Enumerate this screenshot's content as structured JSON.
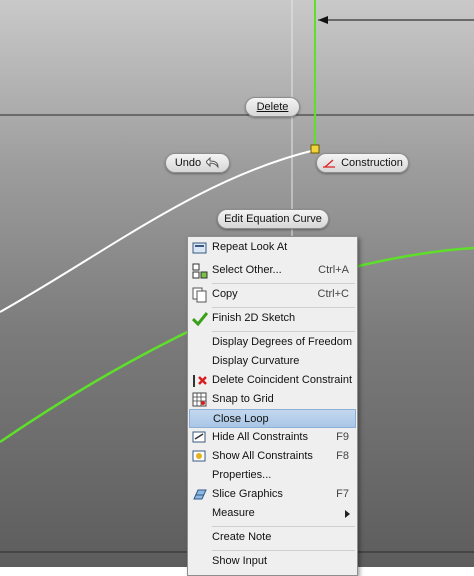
{
  "canvas": {
    "background_top": "#c9c9c9",
    "background_bottom": "#5d5d5d",
    "curve_white": "#ffffff",
    "curve_green": "#5ee02a",
    "axis_line": "#2b2b2b"
  },
  "marking_menu": {
    "delete": "Delete",
    "undo": "Undo",
    "construction": "Construction",
    "edit_equation_curve": "Edit Equation Curve"
  },
  "context_menu": {
    "highlight_color": "#b7cfea",
    "items": [
      {
        "label": "Repeat Look At",
        "shortcut": "",
        "icon": "look-at-icon"
      },
      {
        "label": "Select Other...",
        "shortcut": "Ctrl+A",
        "icon": "select-other-icon"
      },
      {
        "label": "Copy",
        "shortcut": "Ctrl+C",
        "icon": "copy-icon"
      },
      {
        "label": "Finish 2D Sketch",
        "shortcut": "",
        "icon": "checkmark-icon"
      },
      {
        "label": "Display Degrees of Freedom",
        "shortcut": "",
        "icon": ""
      },
      {
        "label": "Display Curvature",
        "shortcut": "",
        "icon": ""
      },
      {
        "label": "Delete Coincident Constraint",
        "shortcut": "",
        "icon": "delete-constraint-icon"
      },
      {
        "label": "Snap to Grid",
        "shortcut": "",
        "icon": "snap-grid-icon"
      },
      {
        "label": "Close Loop",
        "shortcut": "",
        "icon": ""
      },
      {
        "label": "Hide All Constraints",
        "shortcut": "F9",
        "icon": "hide-constraints-icon"
      },
      {
        "label": "Show All Constraints",
        "shortcut": "F8",
        "icon": "show-constraints-icon"
      },
      {
        "label": "Properties...",
        "shortcut": "",
        "icon": ""
      },
      {
        "label": "Slice Graphics",
        "shortcut": "F7",
        "icon": "slice-graphics-icon"
      },
      {
        "label": "Measure",
        "shortcut": "",
        "icon": "submenu-arrow-icon"
      },
      {
        "label": "Create Note",
        "shortcut": "",
        "icon": ""
      },
      {
        "label": "Show Input",
        "shortcut": "",
        "icon": ""
      }
    ]
  }
}
